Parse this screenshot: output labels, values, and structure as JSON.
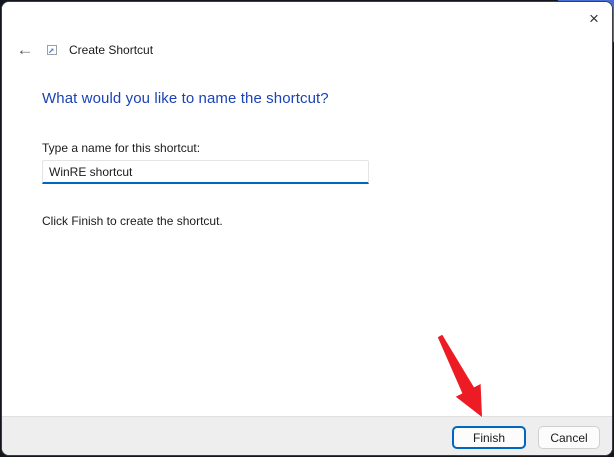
{
  "window": {
    "titlebar": {
      "close_icon": "×"
    },
    "nav": {
      "back_icon": "←",
      "app_icon": "shortcut-overlay-arrow",
      "title": "Create Shortcut"
    },
    "content": {
      "heading": "What would you like to name the shortcut?",
      "input_label": "Type a name for this shortcut:",
      "input_value": "WinRE shortcut",
      "instruction": "Click Finish to create the shortcut."
    },
    "footer": {
      "finish_label": "Finish",
      "cancel_label": "Cancel"
    }
  },
  "annotation": {
    "type": "red-arrow",
    "points_to": "Finish"
  },
  "colors": {
    "accent": "#0067c0",
    "heading": "#1a43b5",
    "arrow": "#ed1c24",
    "footer_bg": "#eeeeee",
    "corner_blue": "#4b6cd4"
  }
}
